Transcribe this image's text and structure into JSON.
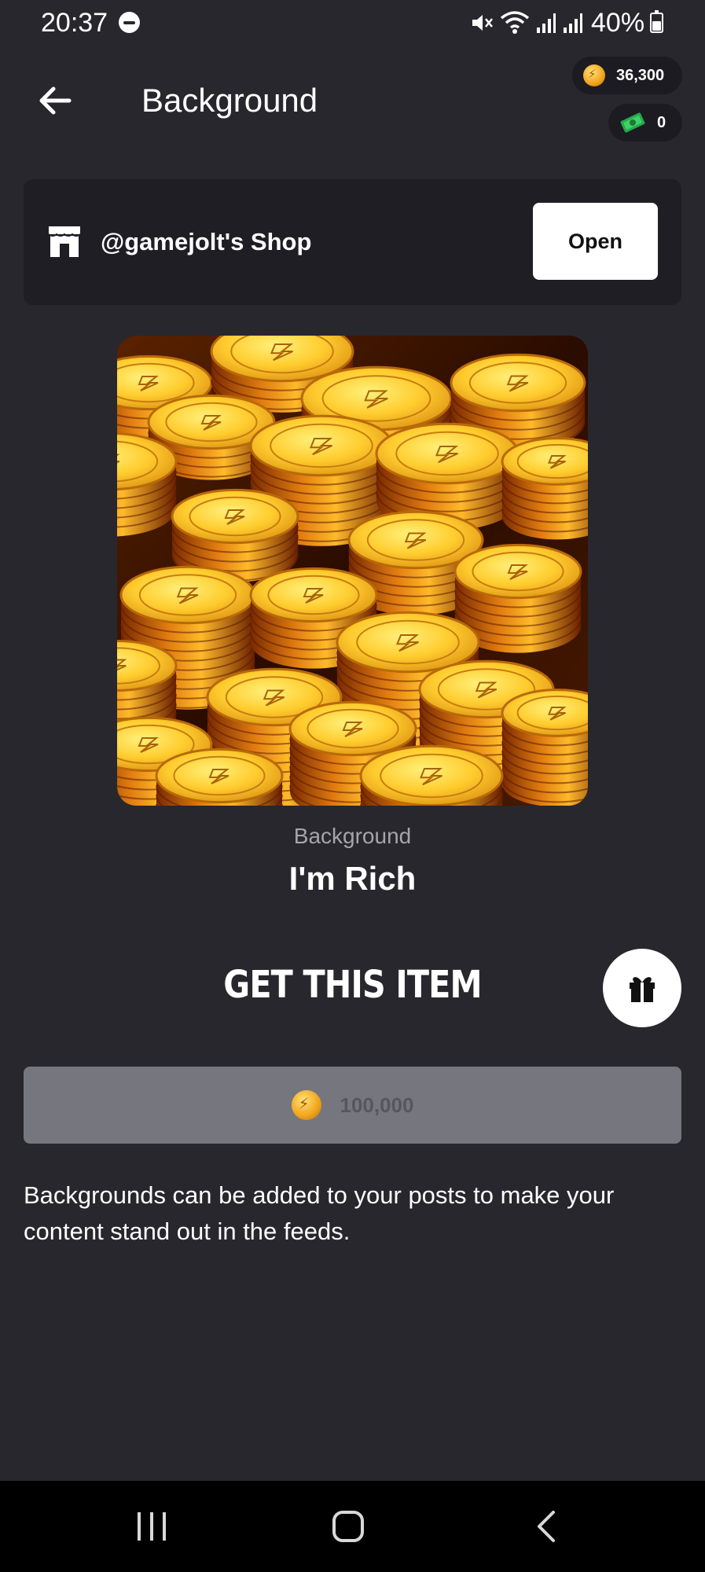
{
  "status_bar": {
    "time": "20:37",
    "battery": "40%"
  },
  "header": {
    "title": "Background",
    "coins": "36,300",
    "cash": "0"
  },
  "shop": {
    "name": "@gamejolt's Shop",
    "open_label": "Open"
  },
  "item": {
    "type": "Background",
    "name": "I'm Rich",
    "image_icon": "gold-coins-pile-image"
  },
  "purchase": {
    "heading": "GET THIS ITEM",
    "price": "100,000"
  },
  "description": "Backgrounds can be added to your posts to make your content stand out in the feeds.",
  "colors": {
    "background": "#28272d",
    "card": "#1f1e24",
    "price_button": "#76777e",
    "coin_gold": "#f0a21a"
  }
}
